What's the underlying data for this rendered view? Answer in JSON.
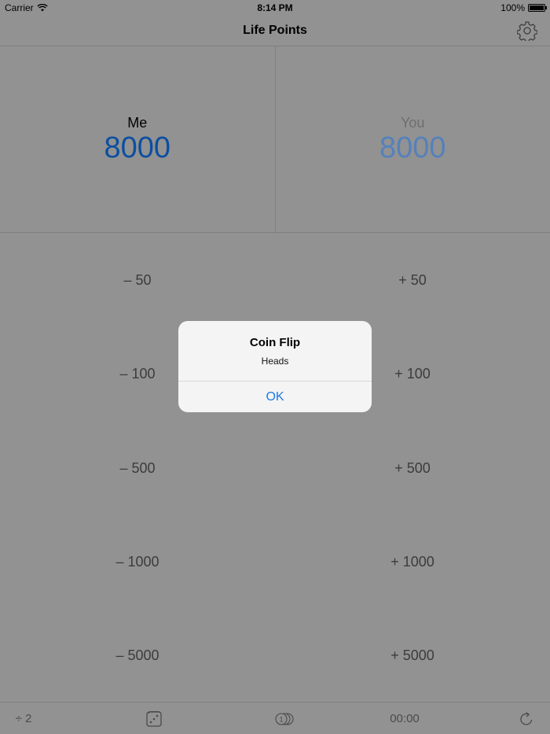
{
  "status_bar": {
    "carrier": "Carrier",
    "time": "8:14 PM",
    "battery": "100%",
    "battery_level": 1.0
  },
  "nav": {
    "title": "Life Points",
    "settings_icon": "gear-icon"
  },
  "players": [
    {
      "name": "Me",
      "score": "8000"
    },
    {
      "name": "You",
      "score": "8000"
    }
  ],
  "adjustments": {
    "minus": [
      "– 50",
      "– 100",
      "– 500",
      "– 1000",
      "– 5000"
    ],
    "plus": [
      "+ 50",
      "+ 100",
      "+ 500",
      "+ 1000",
      "+ 5000"
    ]
  },
  "toolbar": {
    "halve_label": "÷ 2",
    "dice_icon": "dice-icon",
    "coin_icon": "coin-icon",
    "timer": "00:00",
    "reset_icon": "reset-icon"
  },
  "alert": {
    "title": "Coin Flip",
    "message": "Heads",
    "ok_label": "OK"
  },
  "colors": {
    "background": "#929292",
    "player1_score": "#0b4fa0",
    "player2_score": "#5581bb",
    "alert_button": "#1a7be6"
  }
}
